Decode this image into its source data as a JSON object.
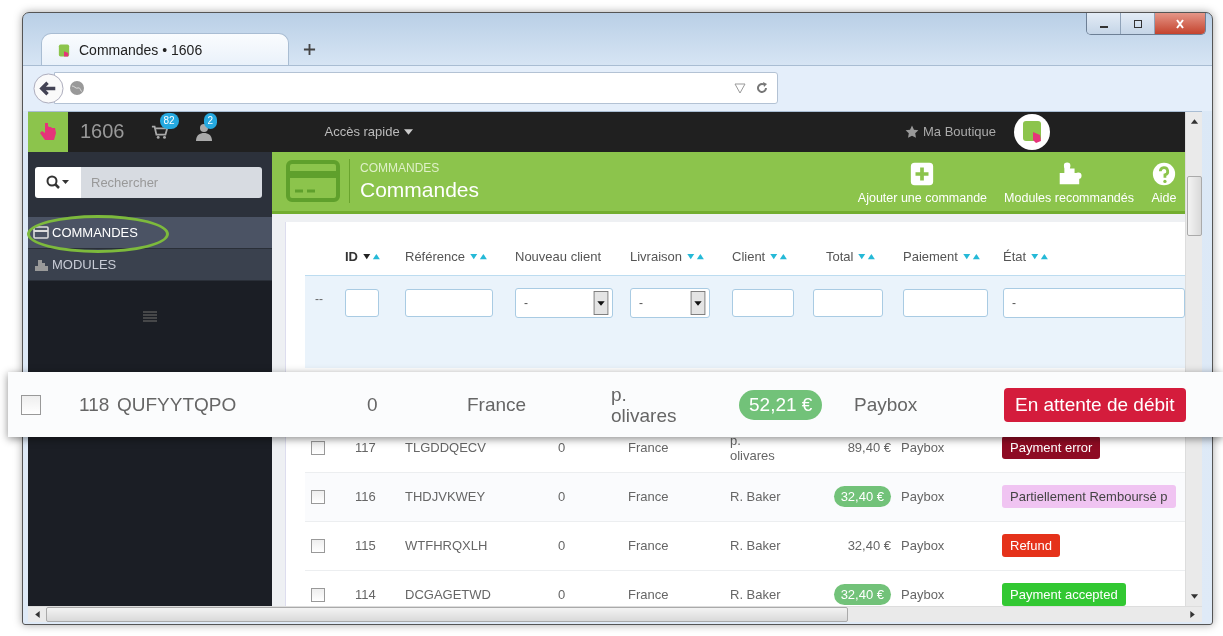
{
  "browser": {
    "tab_title": "Commandes • 1606"
  },
  "topbar": {
    "shop_id": "1606",
    "cart_count": "82",
    "customer_count": "2",
    "quick_access": "Accès rapide",
    "shop_link": "Ma Boutique"
  },
  "sidebar": {
    "search": {
      "placeholder": "Rechercher"
    },
    "items": [
      {
        "label": "COMMANDES",
        "kind": "orders",
        "selected": true
      },
      {
        "label": "MODULES",
        "kind": "modules",
        "selected": false
      }
    ]
  },
  "header": {
    "breadcrumb": "COMMANDES",
    "title": "Commandes",
    "actions": [
      {
        "label": "Ajouter une commande",
        "kind": "add"
      },
      {
        "label": "Modules recommandés",
        "kind": "modules"
      },
      {
        "label": "Aide",
        "kind": "help"
      }
    ]
  },
  "table": {
    "columns": [
      {
        "label": "ID",
        "sortable": true,
        "sorted": true
      },
      {
        "label": "Référence",
        "sortable": true,
        "sorted": false
      },
      {
        "label": "Nouveau client",
        "sortable": false,
        "sorted": false
      },
      {
        "label": "Livraison",
        "sortable": true,
        "sorted": false
      },
      {
        "label": "Client",
        "sortable": true,
        "sorted": false
      },
      {
        "label": "Total",
        "sortable": true,
        "sorted": false
      },
      {
        "label": "Paiement",
        "sortable": true,
        "sorted": false
      },
      {
        "label": "État",
        "sortable": true,
        "sorted": false
      }
    ],
    "filter_label": "--",
    "filters": [
      {
        "kind": "text"
      },
      {
        "kind": "text"
      },
      {
        "kind": "select",
        "value": "-"
      },
      {
        "kind": "select",
        "value": "-"
      },
      {
        "kind": "text"
      },
      {
        "kind": "text"
      },
      {
        "kind": "text"
      },
      {
        "kind": "select-wide",
        "value": "-"
      }
    ],
    "highlighted_row": {
      "checked": false,
      "id": "118",
      "reference": "QUFYYTQPO",
      "new_client": "0",
      "delivery": "France",
      "client": "p. olivares",
      "total": "52,21 €",
      "total_badge": true,
      "payment": "Paybox",
      "status": "En attente de débit",
      "color": "#d41c3c"
    },
    "rows": [
      {
        "checked": false,
        "id": "117",
        "reference": "TLGDDQECV",
        "new_client": "0",
        "delivery": "France",
        "client": "p. olivares",
        "total": "89,40 €",
        "total_badge": false,
        "payment": "Paybox",
        "status": "Payment error",
        "color": "#8e0b23"
      },
      {
        "checked": false,
        "id": "116",
        "reference": "THDJVKWEY",
        "new_client": "0",
        "delivery": "France",
        "client": "R. Baker",
        "total": "32,40 €",
        "total_badge": true,
        "payment": "Paybox",
        "status": "Partiellement Remboursé p",
        "color": "#f0c4f2"
      },
      {
        "checked": false,
        "id": "115",
        "reference": "WTFHRQXLH",
        "new_client": "0",
        "delivery": "France",
        "client": "R. Baker",
        "total": "32,40 €",
        "total_badge": false,
        "payment": "Paybox",
        "status": "Refund",
        "color": "#e5321a"
      },
      {
        "checked": false,
        "id": "114",
        "reference": "DCGAGETWD",
        "new_client": "0",
        "delivery": "France",
        "client": "R. Baker",
        "total": "32,40 €",
        "total_badge": true,
        "payment": "Paybox",
        "status": "Payment accepted",
        "color": "#32c832"
      }
    ]
  }
}
